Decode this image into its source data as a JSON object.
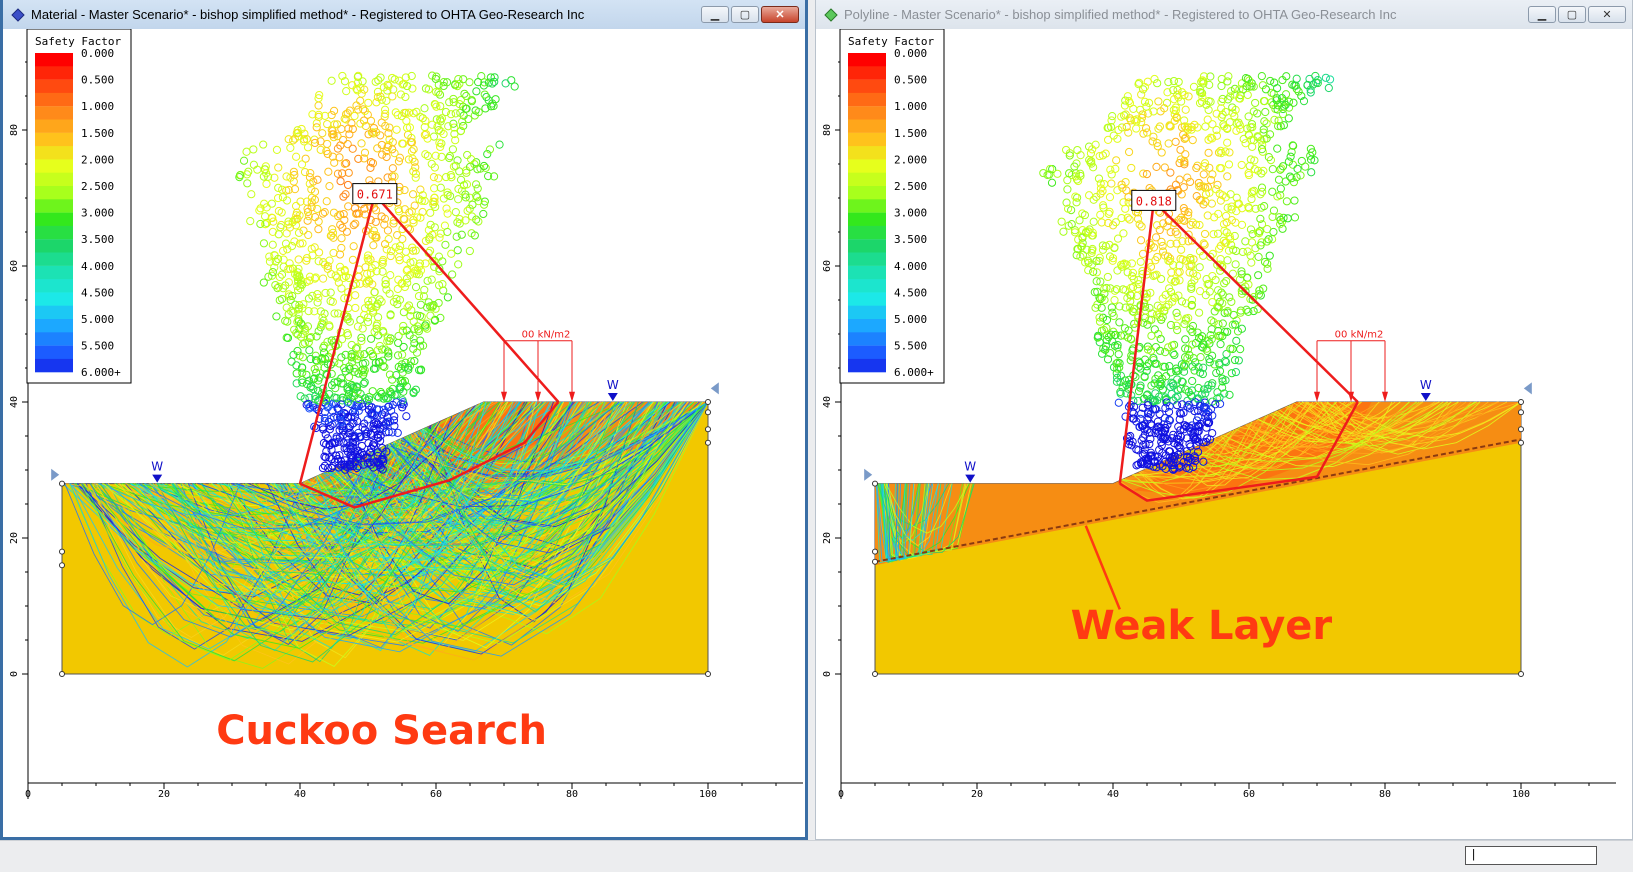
{
  "windows": [
    {
      "id": "left",
      "title": "Material - Master Scenario* - bishop simplified method* - Registered to OHTA Geo-Research Inc",
      "active": true,
      "min_safety_factor": "0.671",
      "caption": "Cuckoo   Search",
      "load_label": "00 kN/m2",
      "water_labels": [
        "W",
        "W"
      ]
    },
    {
      "id": "right",
      "title": "Polyline - Master Scenario* - bishop simplified method* - Registered to OHTA Geo-Research Inc",
      "active": false,
      "min_safety_factor": "0.818",
      "caption": "Weak   Layer",
      "load_label": "00 kN/m2",
      "water_labels": [
        "W",
        "W"
      ]
    }
  ],
  "legend": {
    "title": "Safety Factor",
    "entries": [
      {
        "label": "0.000",
        "color": "#ff0000"
      },
      {
        "label": "0.500",
        "color": "#ff4a10"
      },
      {
        "label": "1.000",
        "color": "#ff8a1a"
      },
      {
        "label": "1.500",
        "color": "#ffc21c"
      },
      {
        "label": "2.000",
        "color": "#e6ff1c"
      },
      {
        "label": "2.500",
        "color": "#a8ff1c"
      },
      {
        "label": "3.000",
        "color": "#33e81c"
      },
      {
        "label": "3.500",
        "color": "#1cd66a"
      },
      {
        "label": "4.000",
        "color": "#1ce2b4"
      },
      {
        "label": "4.500",
        "color": "#1ce8e8"
      },
      {
        "label": "5.000",
        "color": "#1ca8ff"
      },
      {
        "label": "5.500",
        "color": "#1c5cff"
      },
      {
        "label": "6.000+",
        "color": "#1010e0"
      }
    ]
  },
  "axes": {
    "x_ticks": [
      "0",
      "20",
      "40",
      "60",
      "80",
      "100"
    ],
    "y_ticks": [
      "80",
      "60",
      "40",
      "20",
      "0"
    ]
  },
  "colors": {
    "soil": "#f2c800",
    "surface": "#e06a10",
    "critical": "#ee1c1c",
    "annotation": "#ff3a12",
    "water": "#1010c8"
  },
  "statusbar": {
    "field_value": "|"
  }
}
